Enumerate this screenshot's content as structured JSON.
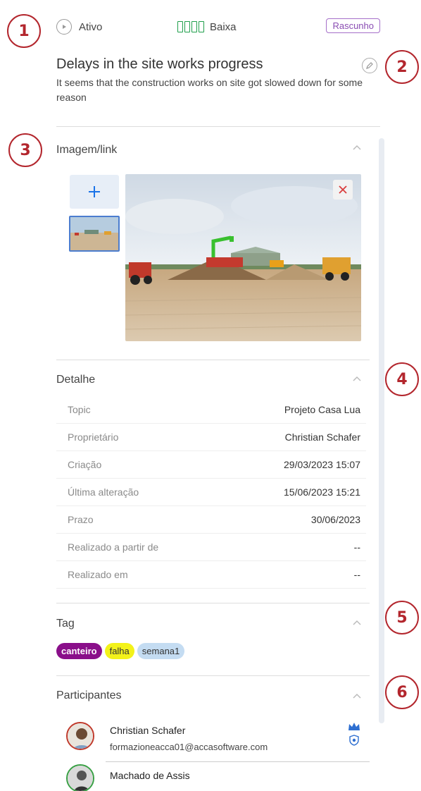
{
  "callouts": [
    "1",
    "2",
    "3",
    "4",
    "5",
    "6"
  ],
  "status": {
    "state": "Ativo",
    "priority": "Baixa",
    "badge": "Rascunho"
  },
  "issue": {
    "title": "Delays in the site works progress",
    "description": "It seems that the construction works on site got slowed down for some reason"
  },
  "sections": {
    "image": "Imagem/link",
    "detail": "Detalhe",
    "tag": "Tag",
    "participants": "Participantes"
  },
  "details": [
    {
      "label": "Topic",
      "value": "Projeto Casa Lua"
    },
    {
      "label": "Proprietário",
      "value": "Christian Schafer"
    },
    {
      "label": "Criação",
      "value": "29/03/2023 15:07"
    },
    {
      "label": "Última alteração",
      "value": "15/06/2023 15:21"
    },
    {
      "label": "Prazo",
      "value": "30/06/2023"
    },
    {
      "label": "Realizado a partir de",
      "value": "--"
    },
    {
      "label": "Realizado em",
      "value": "--"
    }
  ],
  "tags": [
    {
      "label": "canteiro",
      "bg": "#8a0f8a",
      "fg": "#ffffff"
    },
    {
      "label": "falha",
      "bg": "#f3f21a",
      "fg": "#333333"
    },
    {
      "label": "semana1",
      "bg": "#c4dcf2",
      "fg": "#333333"
    }
  ],
  "participants": [
    {
      "name": "Christian Schafer",
      "email": "formazioneacca01@accasoftware.com"
    },
    {
      "name": "Machado de Assis",
      "email": ""
    }
  ],
  "colors": {
    "accent": "#b3262d",
    "priority": "#1e9e4a",
    "draft": "#8a4db3",
    "link": "#1a73e8"
  },
  "icons": {
    "play": "play-circle-icon",
    "edit": "pencil-icon",
    "add": "plus-icon",
    "remove": "close-icon",
    "chevron": "chevron-up-icon",
    "owner": "crown-icon",
    "admin": "shield-gear-icon"
  }
}
